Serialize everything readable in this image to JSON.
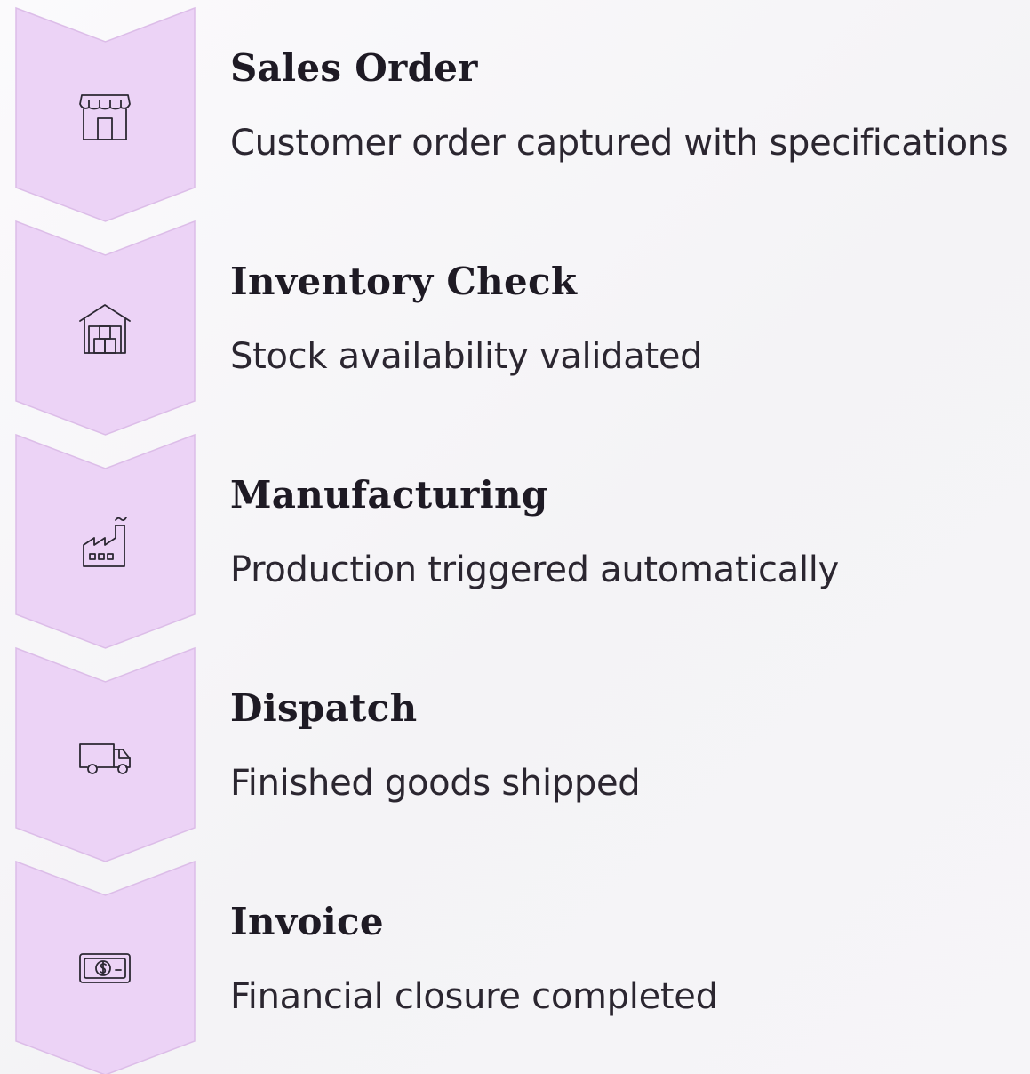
{
  "colors": {
    "chevron_fill": "#ecd3f6",
    "chevron_stroke": "#dcbde8",
    "icon_stroke": "#2c2833",
    "title": "#1e1a24",
    "description": "#2b2630"
  },
  "steps": [
    {
      "icon": "storefront-icon",
      "title": "Sales Order",
      "description": "Customer order captured with specifications"
    },
    {
      "icon": "warehouse-icon",
      "title": "Inventory Check",
      "description": "Stock availability validated"
    },
    {
      "icon": "factory-icon",
      "title": "Manufacturing",
      "description": "Production triggered automatically"
    },
    {
      "icon": "delivery-truck-icon",
      "title": "Dispatch",
      "description": "Finished goods shipped"
    },
    {
      "icon": "cash-icon",
      "title": "Invoice",
      "description": "Financial closure completed"
    }
  ]
}
